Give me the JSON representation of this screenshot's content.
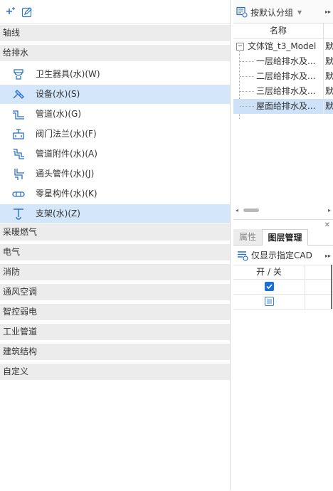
{
  "categories": [
    {
      "label": "轴线"
    },
    {
      "label": "给排水",
      "items": [
        {
          "label": "卫生器具(水)(W)",
          "icon": "sanitary-fixture-icon",
          "selected": false
        },
        {
          "label": "设备(水)(S)",
          "icon": "equipment-icon",
          "selected": true
        },
        {
          "label": "管道(水)(G)",
          "icon": "pipe-icon",
          "selected": false
        },
        {
          "label": "阀门法兰(水)(F)",
          "icon": "valve-flange-icon",
          "selected": false
        },
        {
          "label": "管道附件(水)(A)",
          "icon": "pipe-accessory-icon",
          "selected": false
        },
        {
          "label": "通头管件(水)(J)",
          "icon": "pipe-fitting-icon",
          "selected": false
        },
        {
          "label": "零星构件(水)(K)",
          "icon": "misc-component-icon",
          "selected": false
        },
        {
          "label": "支架(水)(Z)",
          "icon": "support-bracket-icon",
          "selected": true
        }
      ]
    },
    {
      "label": "采暖燃气"
    },
    {
      "label": "电气"
    },
    {
      "label": "消防"
    },
    {
      "label": "通风空调"
    },
    {
      "label": "智控弱电"
    },
    {
      "label": "工业管道"
    },
    {
      "label": "建筑结构"
    },
    {
      "label": "自定义"
    }
  ],
  "group_panel": {
    "group_button_label": "按默认分组",
    "column_name": "名称",
    "root": {
      "label": "文体馆_t3_Model",
      "col2": "默"
    },
    "children": [
      {
        "label": "一层给排水及...",
        "col2": "默",
        "selected": false
      },
      {
        "label": "二层给排水及...",
        "col2": "默",
        "selected": false
      },
      {
        "label": "三层给排水及...",
        "col2": "默",
        "selected": false
      },
      {
        "label": "屋面给排水及...",
        "col2": "默",
        "selected": true
      }
    ]
  },
  "layer_panel": {
    "tabs": [
      {
        "label": "属性"
      },
      {
        "label": "图层管理"
      }
    ],
    "active_tab": "图层管理",
    "filter_label": "仅显示指定CAD",
    "column_on_off": "开 / 关",
    "rows": [
      {
        "state": "checked"
      },
      {
        "state": "partial"
      }
    ]
  },
  "colors": {
    "selection": "#d4e6fa",
    "accent": "#1a6fd6",
    "header_bg": "#ececec"
  }
}
